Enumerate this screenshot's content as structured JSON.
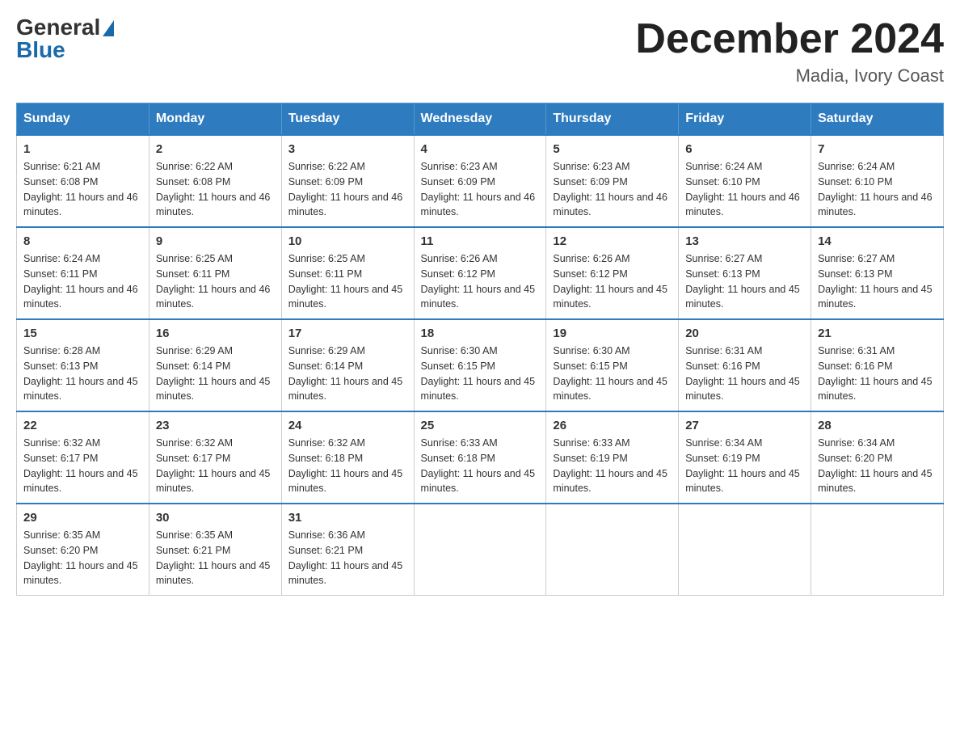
{
  "logo": {
    "general": "General",
    "blue": "Blue"
  },
  "title": "December 2024",
  "location": "Madia, Ivory Coast",
  "days_of_week": [
    "Sunday",
    "Monday",
    "Tuesday",
    "Wednesday",
    "Thursday",
    "Friday",
    "Saturday"
  ],
  "weeks": [
    [
      {
        "day": "1",
        "sunrise": "6:21 AM",
        "sunset": "6:08 PM",
        "daylight": "11 hours and 46 minutes."
      },
      {
        "day": "2",
        "sunrise": "6:22 AM",
        "sunset": "6:08 PM",
        "daylight": "11 hours and 46 minutes."
      },
      {
        "day": "3",
        "sunrise": "6:22 AM",
        "sunset": "6:09 PM",
        "daylight": "11 hours and 46 minutes."
      },
      {
        "day": "4",
        "sunrise": "6:23 AM",
        "sunset": "6:09 PM",
        "daylight": "11 hours and 46 minutes."
      },
      {
        "day": "5",
        "sunrise": "6:23 AM",
        "sunset": "6:09 PM",
        "daylight": "11 hours and 46 minutes."
      },
      {
        "day": "6",
        "sunrise": "6:24 AM",
        "sunset": "6:10 PM",
        "daylight": "11 hours and 46 minutes."
      },
      {
        "day": "7",
        "sunrise": "6:24 AM",
        "sunset": "6:10 PM",
        "daylight": "11 hours and 46 minutes."
      }
    ],
    [
      {
        "day": "8",
        "sunrise": "6:24 AM",
        "sunset": "6:11 PM",
        "daylight": "11 hours and 46 minutes."
      },
      {
        "day": "9",
        "sunrise": "6:25 AM",
        "sunset": "6:11 PM",
        "daylight": "11 hours and 46 minutes."
      },
      {
        "day": "10",
        "sunrise": "6:25 AM",
        "sunset": "6:11 PM",
        "daylight": "11 hours and 45 minutes."
      },
      {
        "day": "11",
        "sunrise": "6:26 AM",
        "sunset": "6:12 PM",
        "daylight": "11 hours and 45 minutes."
      },
      {
        "day": "12",
        "sunrise": "6:26 AM",
        "sunset": "6:12 PM",
        "daylight": "11 hours and 45 minutes."
      },
      {
        "day": "13",
        "sunrise": "6:27 AM",
        "sunset": "6:13 PM",
        "daylight": "11 hours and 45 minutes."
      },
      {
        "day": "14",
        "sunrise": "6:27 AM",
        "sunset": "6:13 PM",
        "daylight": "11 hours and 45 minutes."
      }
    ],
    [
      {
        "day": "15",
        "sunrise": "6:28 AM",
        "sunset": "6:13 PM",
        "daylight": "11 hours and 45 minutes."
      },
      {
        "day": "16",
        "sunrise": "6:29 AM",
        "sunset": "6:14 PM",
        "daylight": "11 hours and 45 minutes."
      },
      {
        "day": "17",
        "sunrise": "6:29 AM",
        "sunset": "6:14 PM",
        "daylight": "11 hours and 45 minutes."
      },
      {
        "day": "18",
        "sunrise": "6:30 AM",
        "sunset": "6:15 PM",
        "daylight": "11 hours and 45 minutes."
      },
      {
        "day": "19",
        "sunrise": "6:30 AM",
        "sunset": "6:15 PM",
        "daylight": "11 hours and 45 minutes."
      },
      {
        "day": "20",
        "sunrise": "6:31 AM",
        "sunset": "6:16 PM",
        "daylight": "11 hours and 45 minutes."
      },
      {
        "day": "21",
        "sunrise": "6:31 AM",
        "sunset": "6:16 PM",
        "daylight": "11 hours and 45 minutes."
      }
    ],
    [
      {
        "day": "22",
        "sunrise": "6:32 AM",
        "sunset": "6:17 PM",
        "daylight": "11 hours and 45 minutes."
      },
      {
        "day": "23",
        "sunrise": "6:32 AM",
        "sunset": "6:17 PM",
        "daylight": "11 hours and 45 minutes."
      },
      {
        "day": "24",
        "sunrise": "6:32 AM",
        "sunset": "6:18 PM",
        "daylight": "11 hours and 45 minutes."
      },
      {
        "day": "25",
        "sunrise": "6:33 AM",
        "sunset": "6:18 PM",
        "daylight": "11 hours and 45 minutes."
      },
      {
        "day": "26",
        "sunrise": "6:33 AM",
        "sunset": "6:19 PM",
        "daylight": "11 hours and 45 minutes."
      },
      {
        "day": "27",
        "sunrise": "6:34 AM",
        "sunset": "6:19 PM",
        "daylight": "11 hours and 45 minutes."
      },
      {
        "day": "28",
        "sunrise": "6:34 AM",
        "sunset": "6:20 PM",
        "daylight": "11 hours and 45 minutes."
      }
    ],
    [
      {
        "day": "29",
        "sunrise": "6:35 AM",
        "sunset": "6:20 PM",
        "daylight": "11 hours and 45 minutes."
      },
      {
        "day": "30",
        "sunrise": "6:35 AM",
        "sunset": "6:21 PM",
        "daylight": "11 hours and 45 minutes."
      },
      {
        "day": "31",
        "sunrise": "6:36 AM",
        "sunset": "6:21 PM",
        "daylight": "11 hours and 45 minutes."
      },
      null,
      null,
      null,
      null
    ]
  ]
}
